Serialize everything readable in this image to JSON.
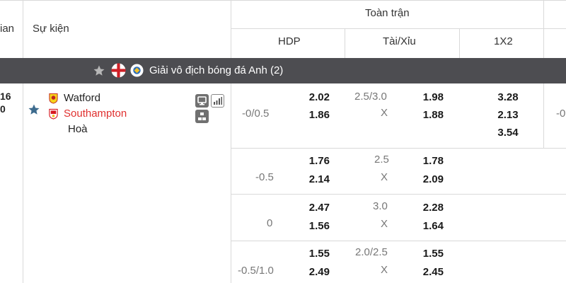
{
  "header": {
    "time_col": "ian",
    "event_col": "Sự kiện",
    "group_title": "Toàn trận",
    "hdp": "HDP",
    "ou": "Tài/Xỉu",
    "onex2": "1X2"
  },
  "league": {
    "name": "Giải vô địch bóng đá Anh (2)",
    "colors": {
      "bar": "#4d4d51",
      "england_red": "#cf2027"
    }
  },
  "match": {
    "time_line1": "16",
    "time_line2": "0",
    "home": "Watford",
    "away": "Southampton",
    "draw": "Hoà",
    "away_color": "#e0302f",
    "right_edge_partial": "-0"
  },
  "rows": [
    {
      "hdp_line": "-0/0.5",
      "hdp_home": "2.02",
      "hdp_away": "1.86",
      "ou_line": "2.5/3.0",
      "ou_x": "X",
      "ou_over": "1.98",
      "ou_under": "1.88",
      "x12": [
        "3.28",
        "2.13",
        "3.54"
      ]
    },
    {
      "hdp_line": "-0.5",
      "hdp_home": "1.76",
      "hdp_away": "2.14",
      "ou_line": "2.5",
      "ou_x": "X",
      "ou_over": "1.78",
      "ou_under": "2.09"
    },
    {
      "hdp_line": "0",
      "hdp_home": "2.47",
      "hdp_away": "1.56",
      "ou_line": "3.0",
      "ou_x": "X",
      "ou_over": "2.28",
      "ou_under": "1.64"
    },
    {
      "hdp_line": "-0.5/1.0",
      "hdp_home": "1.55",
      "hdp_away": "2.49",
      "ou_line": "2.0/2.5",
      "ou_x": "X",
      "ou_over": "1.55",
      "ou_under": "2.45"
    }
  ],
  "icons": [
    "star-icon",
    "england-flag-icon",
    "league-badge-icon",
    "favorite-star-icon",
    "watford-crest-icon",
    "southampton-crest-icon",
    "tv-icon",
    "stats-icon",
    "lineup-icon"
  ]
}
